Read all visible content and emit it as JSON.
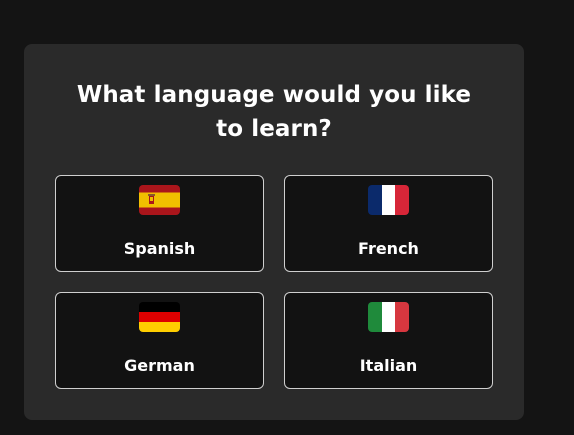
{
  "prompt": {
    "title": "What language would you like to learn?"
  },
  "options": [
    {
      "label": "Spanish",
      "flag_icon": "spain-flag-icon",
      "colors": [
        "#aa151b",
        "#f1bf00",
        "#aa151b"
      ]
    },
    {
      "label": "French",
      "flag_icon": "france-flag-icon",
      "colors": [
        "#0b2a6b",
        "#ffffff",
        "#d72638"
      ]
    },
    {
      "label": "German",
      "flag_icon": "germany-flag-icon",
      "colors": [
        "#000000",
        "#dd0000",
        "#ffce00"
      ]
    },
    {
      "label": "Italian",
      "flag_icon": "italy-flag-icon",
      "colors": [
        "#1f8a3b",
        "#ffffff",
        "#d7373f"
      ]
    }
  ],
  "theme": {
    "background": "#141414",
    "card": "#2a2a2a",
    "option_background": "#121212",
    "option_border": "#cfcfcf",
    "text": "#ffffff"
  }
}
